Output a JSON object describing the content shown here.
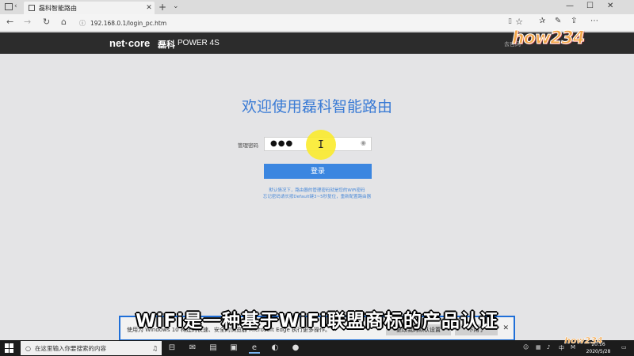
{
  "browser": {
    "tab_title": "磊科智能路由",
    "url": "192.168.0.1/login_pc.htm",
    "controls": {
      "minimize": "—",
      "maximize": "☐",
      "close": "✕"
    }
  },
  "router": {
    "brand": "net·core",
    "brand_cn": "磊科",
    "model": "POWER 4S",
    "header_link": "去官网",
    "welcome": "欢迎使用磊科智能路由",
    "password_label": "管理密码",
    "password_dots": "●●●",
    "login_label": "登录",
    "hint_line1": "默认情况下，路由器的管理密码就是您的WiFi密码",
    "hint_line2": "忘记密码请长按Default键3~5秒复位，重新配置路由器"
  },
  "watermark": {
    "text": "how234",
    "small": "how234"
  },
  "notification": {
    "text": "使用为 Windows 10 构建的快速、安全的浏览器 Microsoft Edge 执行更多操作。",
    "primary": "更改我的默认设置",
    "secondary": "不用了"
  },
  "subtitle": "WiFi是一种基于WiFi联盟商标的产品认证",
  "taskbar": {
    "search_placeholder": "在这里输入你要搜索的内容",
    "clock_time": "20:16",
    "clock_date": "2020/5/28",
    "ime": "中",
    "ime2": "M"
  },
  "colors": {
    "accent": "#3b86e0",
    "header_bg": "#2c2c2c",
    "page_bg": "#e4e4e6"
  }
}
